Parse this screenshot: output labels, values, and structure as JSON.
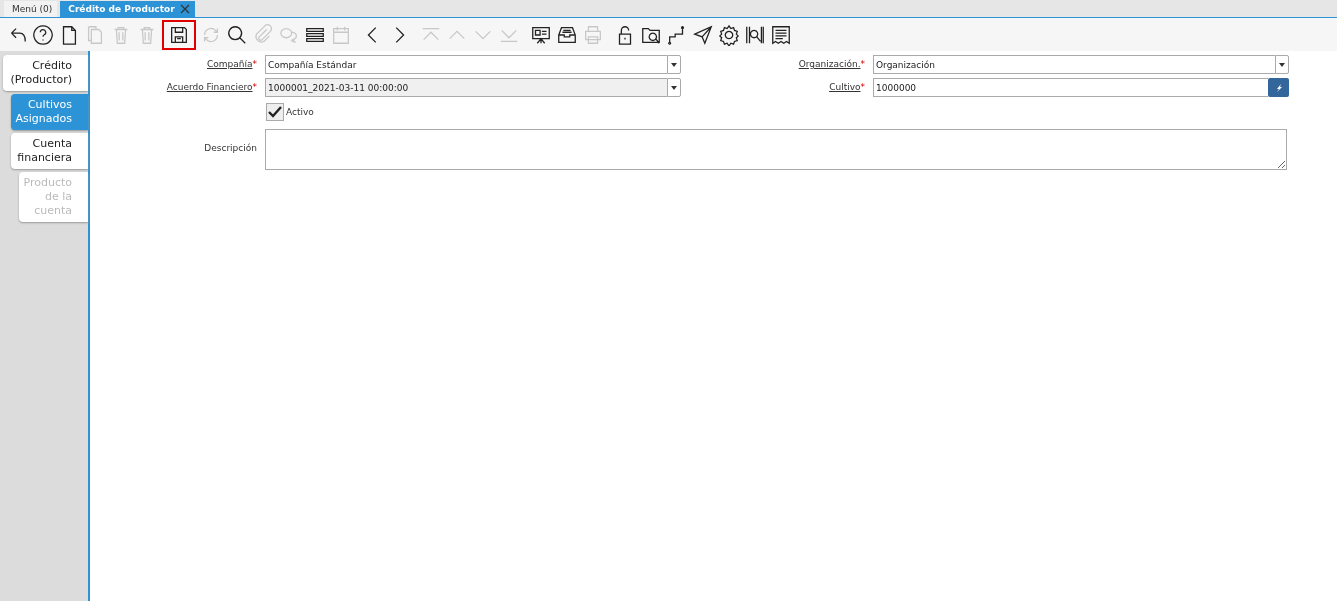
{
  "window_tabs": [
    {
      "label": "Menú (0)",
      "selected": false
    },
    {
      "label": "Crédito de Productor",
      "selected": true,
      "closable": true
    }
  ],
  "toolbar": [
    {
      "kind": "undo",
      "disabled": false
    },
    {
      "kind": "help",
      "disabled": false
    },
    {
      "kind": "new",
      "disabled": false
    },
    {
      "kind": "copy",
      "disabled": true
    },
    {
      "kind": "delete",
      "disabled": true
    },
    {
      "kind": "delete",
      "disabled": true
    },
    {
      "kind": "save",
      "disabled": false,
      "highlighted": true
    },
    {
      "kind": "refresh",
      "disabled": true
    },
    {
      "kind": "find",
      "disabled": false
    },
    {
      "kind": "attach",
      "disabled": true
    },
    {
      "kind": "chat",
      "disabled": true
    },
    {
      "kind": "grid",
      "disabled": false
    },
    {
      "kind": "calendar",
      "disabled": true
    },
    {
      "kind": "prev",
      "disabled": false
    },
    {
      "kind": "next",
      "disabled": false
    },
    {
      "kind": "first",
      "disabled": true
    },
    {
      "kind": "up",
      "disabled": true
    },
    {
      "kind": "down",
      "disabled": true
    },
    {
      "kind": "last",
      "disabled": true
    },
    {
      "kind": "report",
      "disabled": false
    },
    {
      "kind": "archive",
      "disabled": false
    },
    {
      "kind": "print",
      "disabled": true
    },
    {
      "kind": "lock",
      "disabled": false
    },
    {
      "kind": "zoom",
      "disabled": false
    },
    {
      "kind": "workflow",
      "disabled": false
    },
    {
      "kind": "send",
      "disabled": false
    },
    {
      "kind": "gear",
      "disabled": false
    },
    {
      "kind": "barcode",
      "disabled": false
    },
    {
      "kind": "form",
      "disabled": false
    }
  ],
  "side_tabs": [
    {
      "label": "Crédito (Productor)",
      "selected": false,
      "disabled": false,
      "children": [
        {
          "label": "Cultivos Asignados",
          "selected": true,
          "disabled": false
        },
        {
          "label": "Cuenta financiera",
          "selected": false,
          "disabled": false,
          "children": [
            {
              "label": "Producto de la cuenta",
              "selected": false,
              "disabled": true
            }
          ]
        }
      ]
    }
  ],
  "form": {
    "company": {
      "label": "Compañía",
      "value": "Compañía Estándar",
      "required_mark": "*",
      "readonly": false
    },
    "organization": {
      "label": "Organización.",
      "value": "Organización",
      "required_mark": "*",
      "readonly": false
    },
    "agreement": {
      "label": "Acuerdo Financiero",
      "value": "1000001_2021-03-11 00:00:00",
      "required_mark": "*",
      "readonly": true
    },
    "crop": {
      "label": "Cultivo",
      "value": "1000000",
      "required_mark": "*",
      "readonly": false
    },
    "active": {
      "label": "Activo",
      "checked": true
    },
    "description": {
      "label": "Descripción"
    }
  }
}
